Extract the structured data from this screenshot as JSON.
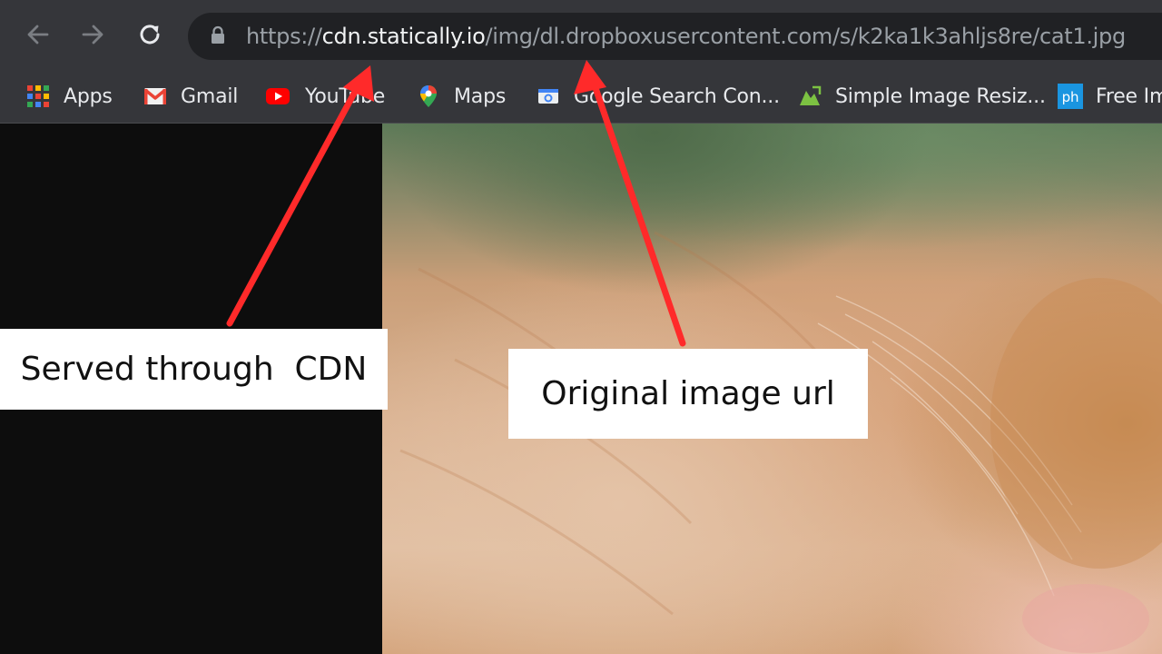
{
  "browser": {
    "url": {
      "scheme": "https://",
      "host": "cdn.statically.io",
      "path": "/img/dl.dropboxusercontent.com/s/k2ka1k3ahljs8re/cat1.jpg"
    },
    "bookmarks": [
      {
        "label": "Apps",
        "icon": "apps-grid-icon"
      },
      {
        "label": "Gmail",
        "icon": "gmail-icon"
      },
      {
        "label": "YouTube",
        "icon": "youtube-icon"
      },
      {
        "label": "Maps",
        "icon": "maps-pin-icon"
      },
      {
        "label": "Google Search Con...",
        "icon": "search-console-icon"
      },
      {
        "label": "Simple Image Resiz...",
        "icon": "image-resizer-icon"
      },
      {
        "label": "Free Im",
        "icon": "ph-icon"
      }
    ]
  },
  "annotations": {
    "cdn_label": "Served through  CDN",
    "original_label": "Original image url",
    "arrow_color": "#ff2a2a"
  },
  "colors": {
    "chrome_bg": "#35363a",
    "omnibox_bg": "#202124",
    "page_bg": "#0d0d0d"
  }
}
